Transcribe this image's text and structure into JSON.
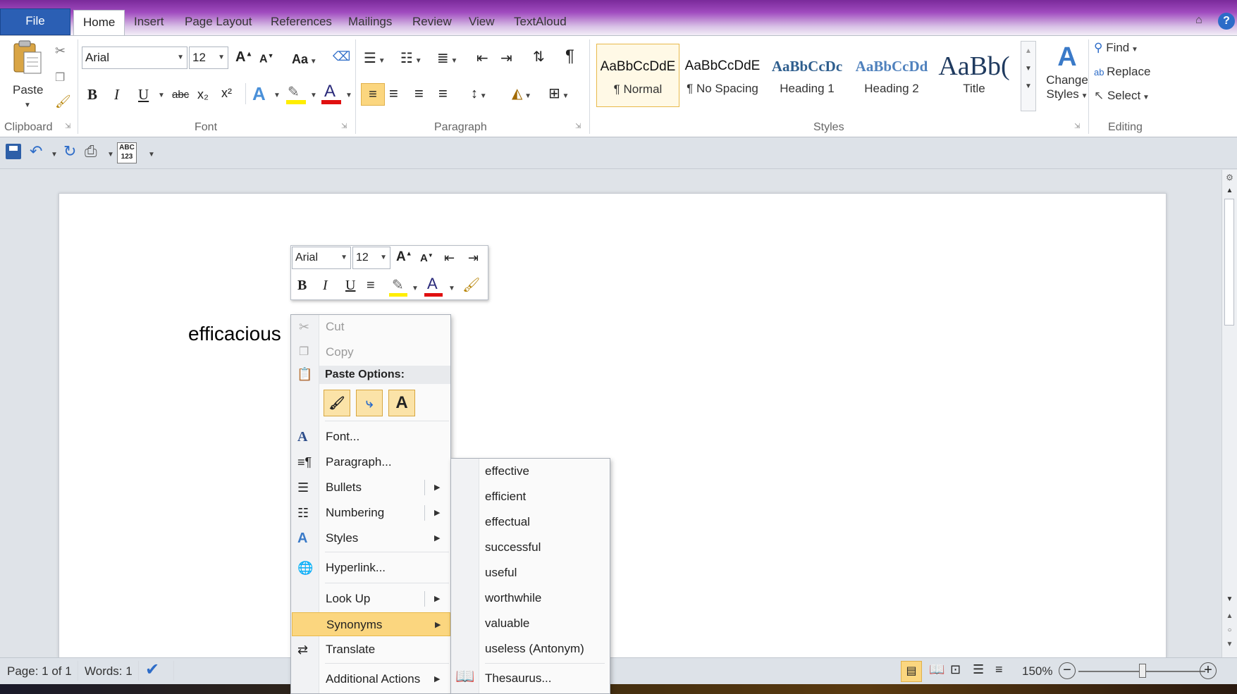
{
  "tabs": [
    "File",
    "Home",
    "Insert",
    "Page Layout",
    "References",
    "Mailings",
    "Review",
    "View",
    "TextAloud"
  ],
  "ribbon": {
    "clipboard": {
      "paste": "Paste",
      "label": "Clipboard"
    },
    "font": {
      "family": "Arial",
      "size": "12",
      "label": "Font",
      "bold": "B",
      "italic": "I",
      "underline": "U",
      "strike": "abc",
      "sub": "x₂",
      "sup": "x²",
      "grow": "A",
      "shrink": "A",
      "case": "Aa",
      "color_glyph": "A"
    },
    "paragraph": {
      "label": "Paragraph",
      "pilcrow": "¶"
    },
    "styles": {
      "label": "Styles",
      "items": [
        {
          "preview": "AaBbCcDdE",
          "name": "¶ Normal"
        },
        {
          "preview": "AaBbCcDdE",
          "name": "¶ No Spacing"
        },
        {
          "preview": "AaBbCcDc",
          "name": "Heading 1"
        },
        {
          "preview": "AaBbCcDd",
          "name": "Heading 2"
        },
        {
          "preview": "AaBb(",
          "name": "Title"
        }
      ],
      "change_line1": "Change",
      "change_line2": "Styles"
    },
    "editing": {
      "label": "Editing",
      "find": "Find",
      "replace": "Replace",
      "select": "Select"
    }
  },
  "qat": {
    "abc": "ABC",
    "num": "123"
  },
  "document": {
    "text": "efficacious"
  },
  "mini_toolbar": {
    "font": "Arial",
    "size": "12",
    "bold": "B",
    "italic": "I",
    "underline": "U",
    "color_glyph": "A"
  },
  "context_menu": {
    "cut": "Cut",
    "copy": "Copy",
    "paste_options": "Paste Options:",
    "font": "Font...",
    "paragraph": "Paragraph...",
    "bullets": "Bullets",
    "numbering": "Numbering",
    "styles": "Styles",
    "hyperlink": "Hyperlink...",
    "look_up": "Look Up",
    "synonyms": "Synonyms",
    "translate": "Translate",
    "additional_actions": "Additional Actions"
  },
  "synonyms_menu": {
    "items": [
      "effective",
      "efficient",
      "effectual",
      "successful",
      "useful",
      "worthwhile",
      "valuable",
      "useless (Antonym)"
    ],
    "thesaurus": "Thesaurus..."
  },
  "status": {
    "page": "Page: 1 of 1",
    "words": "Words: 1",
    "zoom": "150%"
  },
  "colors": {
    "file_tab": "#2b5fb4",
    "highlight": "#fbd67f",
    "font_color": "#e01010",
    "text_highlight": "#ffee00",
    "title_bar": "#7a2a9a"
  }
}
